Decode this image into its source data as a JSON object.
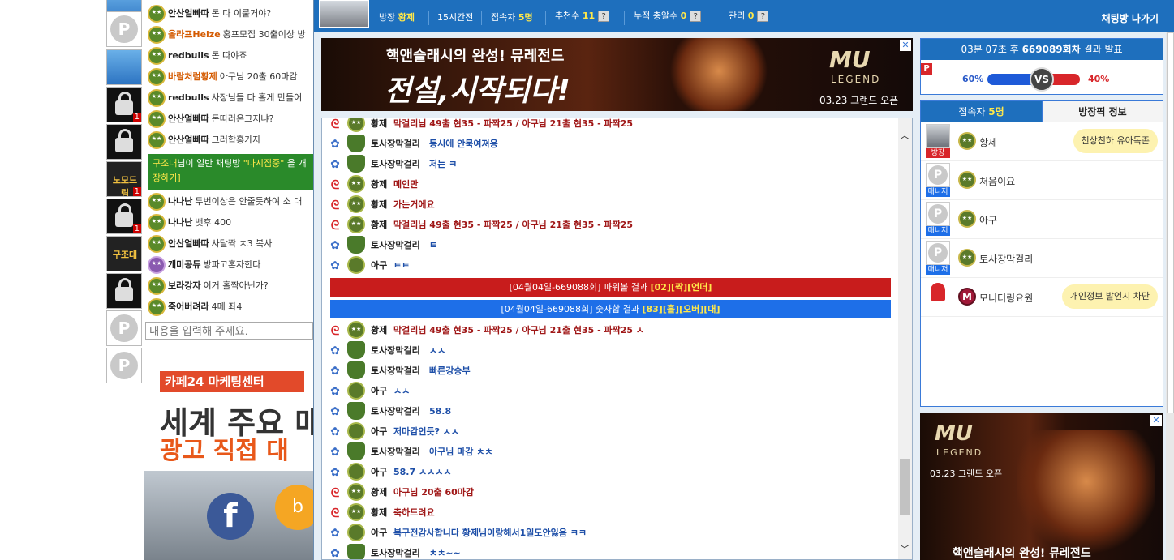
{
  "left_avatars": [
    {
      "type": "img1",
      "badge": "1"
    },
    {
      "type": "p"
    },
    {
      "type": "img1"
    },
    {
      "type": "lock",
      "badge": "1"
    },
    {
      "type": "lock"
    },
    {
      "type": "gold",
      "label": "노모드림",
      "badge": "1"
    },
    {
      "type": "lock",
      "badge": "1"
    },
    {
      "type": "gold",
      "label": "구조대"
    },
    {
      "type": "lock"
    },
    {
      "type": "p"
    },
    {
      "type": "p"
    }
  ],
  "left_chat": [
    {
      "nick": "안산얼빠따",
      "msg": "돈 다 이룰거야?"
    },
    {
      "nick": "올라프Heize",
      "msg": "홍프모집 30출이상 방",
      "nick_color": "orange"
    },
    {
      "nick": "redbulls",
      "msg": "돈 따야죠"
    },
    {
      "nick": "바람처럼황제",
      "msg": "아구님 20출 60마감",
      "nick_color": "orange"
    },
    {
      "nick": "redbulls",
      "msg": "사장님들 다 홀게 만들어"
    },
    {
      "nick": "안산얼빠따",
      "msg": "돈따러온그지냐?"
    },
    {
      "nick": "안산얼빠따",
      "msg": "그러합홍가자"
    }
  ],
  "left_chat_bottom": [
    {
      "nick": "나나난",
      "msg": "두번이상은 안줄듯하여 소 대"
    },
    {
      "nick": "나나난",
      "msg": "뱃후 400"
    },
    {
      "nick": "안산얼빠따",
      "msg": "사달짝 ㅈ3 복사"
    },
    {
      "nick": "개미공듀",
      "msg": "방파고혼자한다",
      "rank": "purple"
    },
    {
      "nick": "보라강자",
      "msg": "이거 홀짝아닌가?"
    },
    {
      "nick": "죽어버려라",
      "msg": "4메 좌4"
    }
  ],
  "left_notice": {
    "pre": "구조대",
    "mid": "님이 일반 채팅방 ",
    "quoted": "\"다시집중\"",
    "post": " 을 개",
    "line2": "장하기]"
  },
  "left_input_placeholder": "내용을 입력해 주세요.",
  "left_ad": {
    "tag": "카페24 마케팅센터",
    "line1": "세계 주요 매",
    "line2": "광고 직접 대",
    "fb": "f",
    "bing": "b"
  },
  "topbar": {
    "owner_label": "방장",
    "owner": "황제",
    "elapsed": "15시간전",
    "users_label": "접속자",
    "users": "5명",
    "rec_label": "추천수",
    "rec": "11",
    "total_label": "누적 충알수",
    "total": "0",
    "admin_label": "관리",
    "admin": "0",
    "q": "?",
    "exit": "채팅방 나가기"
  },
  "banner_top": {
    "t1": "핵앤슬래시의 완성! 뮤레전드",
    "t2": "전설,시작되다!",
    "logo": "MU",
    "logo2": "LEGEND",
    "date": "03.23 그랜드 오픈",
    "x": "✕"
  },
  "chat": [
    {
      "icon": "red",
      "badge": "stars",
      "nick": "황제",
      "text": "막걸리님 49출 현35 - 파짝25 / 아구님 21출 현35 - 파짝25",
      "tone": "red"
    },
    {
      "icon": "blue",
      "badge": "cap",
      "nick": "토사장막걸리",
      "text": "동시에 안묵여져용",
      "tone": "blue"
    },
    {
      "icon": "blue",
      "badge": "cap",
      "nick": "토사장막걸리",
      "text": "저는 ㅋ",
      "tone": "blue"
    },
    {
      "icon": "red",
      "badge": "stars",
      "nick": "황제",
      "text": "메인만",
      "tone": "red"
    },
    {
      "icon": "red",
      "badge": "stars",
      "nick": "황제",
      "text": "가는거에요",
      "tone": "red"
    },
    {
      "icon": "red",
      "badge": "stars",
      "nick": "황제",
      "text": "막걸리님 49출 현35 - 파짝25 / 아구님 21출 현35 - 파짝25",
      "tone": "red"
    },
    {
      "icon": "blue",
      "badge": "cap",
      "nick": "토사장막걸리",
      "text": "ㅌ",
      "tone": "blue"
    },
    {
      "icon": "blue",
      "badge": "plain",
      "nick": "아구",
      "text": "ㅌㅌ",
      "tone": "blue"
    }
  ],
  "result_bars": [
    {
      "pre": "[04월04일-669088회] 파워볼 결과 ",
      "a": "[02]",
      "b": "[짝]",
      "c": "[언더]",
      "tone": "red"
    },
    {
      "pre": "[04월04일-669088회] 숫자합 결과 ",
      "a": "[83]",
      "b": "[홀]",
      "c": "[오버]",
      "d": "[대]",
      "tone": "blue"
    }
  ],
  "chat2": [
    {
      "icon": "red",
      "badge": "stars",
      "nick": "황제",
      "text": "막걸리님 49출 현35 - 파짝25 / 아구님 21출 현35 - 파짝25 ㅅ",
      "tone": "red"
    },
    {
      "icon": "blue",
      "badge": "cap",
      "nick": "토사장막걸리",
      "text": "ㅅㅅ",
      "tone": "blue"
    },
    {
      "icon": "blue",
      "badge": "cap",
      "nick": "토사장막걸리",
      "text": "빠른강승부",
      "tone": "blue"
    },
    {
      "icon": "blue",
      "badge": "plain",
      "nick": "아구",
      "text": "ㅅㅅ",
      "tone": "blue"
    },
    {
      "icon": "blue",
      "badge": "cap",
      "nick": "토사장막걸리",
      "text": "58.8",
      "tone": "blue"
    },
    {
      "icon": "blue",
      "badge": "plain",
      "nick": "아구",
      "text": "저마감인듯? ㅅㅅ",
      "tone": "blue"
    },
    {
      "icon": "blue",
      "badge": "cap",
      "nick": "토사장막걸리",
      "text": "아구님 마감 ㅊㅊ",
      "tone": "blue"
    },
    {
      "icon": "blue",
      "badge": "plain",
      "nick": "아구",
      "text": "58.7  ㅅㅅㅅㅅ",
      "tone": "blue"
    },
    {
      "icon": "red",
      "badge": "stars",
      "nick": "황제",
      "text": "아구님 20출 60마감",
      "tone": "red"
    },
    {
      "icon": "red",
      "badge": "stars",
      "nick": "황제",
      "text": "축하드려요",
      "tone": "red"
    },
    {
      "icon": "blue",
      "badge": "plain",
      "nick": "아구",
      "text": "복구전감사합니다 황제님이랑해서1일도안잃음 ㅋㅋ",
      "tone": "blue"
    },
    {
      "icon": "blue",
      "badge": "cap",
      "nick": "토사장막걸리",
      "text": "ㅊㅊ~~",
      "tone": "blue"
    }
  ],
  "vs_panel": {
    "time": "03분 07초 후",
    "round": "669089회차",
    "suffix": " 결과 발표",
    "p": "P",
    "left_pct": "60%",
    "right_pct": "40%",
    "vs": "VS",
    "left_share": 0.6,
    "right_share": 0.4
  },
  "users_panel": {
    "tab_users_label": "접속자 ",
    "tab_users_count": "5명",
    "tab_info": "방장픽 정보",
    "users": [
      {
        "name": "황제",
        "role": "방장",
        "role_type": "own",
        "photo": "owner",
        "badge": "stars",
        "bubble": "천상천하 유아독존"
      },
      {
        "name": "처음이요",
        "role": "매니저",
        "role_type": "mgr",
        "photo": "p",
        "badge": "cap"
      },
      {
        "name": "아구",
        "role": "매니저",
        "role_type": "mgr",
        "photo": "p",
        "badge": "cap"
      },
      {
        "name": "토사장막걸리",
        "role": "매니저",
        "role_type": "mgr",
        "photo": "p",
        "badge": "cap"
      },
      {
        "name": "모니터링요원",
        "role": "",
        "role_type": "",
        "photo": "siren",
        "badge": "m",
        "badge_text": "M",
        "bubble": "개인정보 발언시 차단"
      }
    ]
  },
  "banner_side": {
    "logo": "MU",
    "logo2": "LEGEND",
    "date": "03.23 그랜드 오픈",
    "bottom": "핵앤슬래시의 완성! 뮤레전드",
    "x": "✕"
  },
  "colors": {
    "blue": "#1e6fbd",
    "red": "#c81c1c",
    "yellow": "#ffe84a"
  }
}
